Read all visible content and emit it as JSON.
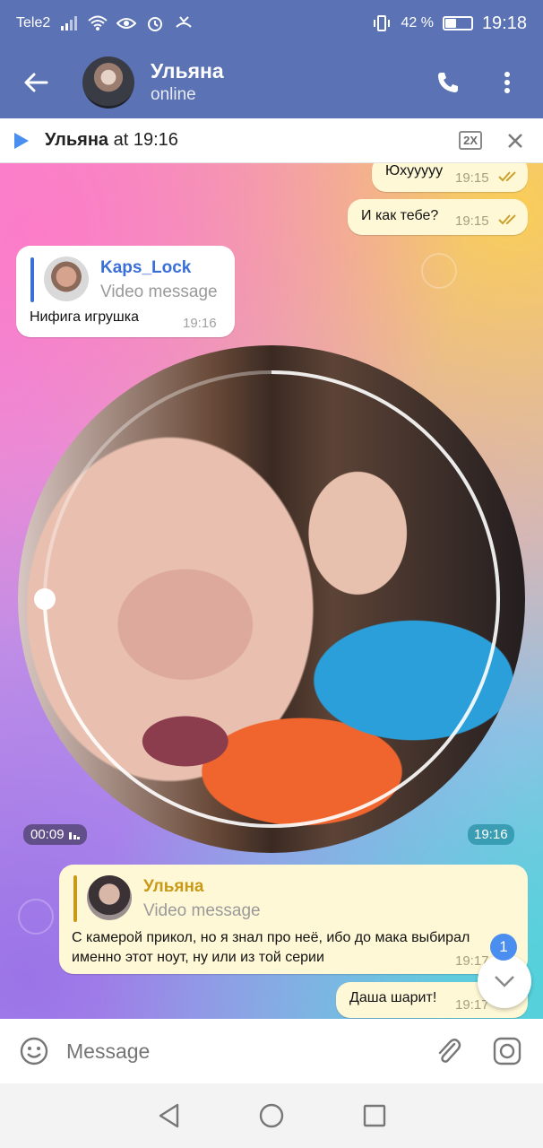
{
  "status_bar": {
    "carrier": "Tele2",
    "battery": "42 %",
    "battery_level": 0.42,
    "time": "19:18"
  },
  "header": {
    "name": "Ульяна",
    "status": "online"
  },
  "player": {
    "name": "Ульяна",
    "at": "at 19:16",
    "speed": "2X"
  },
  "messages": {
    "m1": {
      "text": "Юхууууу",
      "time": "19:15"
    },
    "m2": {
      "text": "И как тебе?",
      "time": "19:15"
    },
    "m3": {
      "reply_name": "Kaps_Lock",
      "reply_sub": "Video message",
      "text": "Нифига игрушка",
      "time": "19:16"
    },
    "video": {
      "duration": "00:09",
      "time": "19:16",
      "progress": 0.75
    },
    "m4": {
      "reply_name": "Ульяна",
      "reply_sub": "Video message",
      "text_line1": "С камерой прикол, но я знал про неё, ибо до мака выбирал",
      "text_line2": "именно этот ноут, ну или из той серии",
      "time": "19:17"
    },
    "m5": {
      "text": "Даша шарит!",
      "time": "19:17"
    }
  },
  "scroll": {
    "unread": "1"
  },
  "input": {
    "placeholder": "Message"
  },
  "colors": {
    "header": "#5b73b4",
    "accent": "#4a8ef0",
    "reply_in": "#3a6fd8",
    "reply_out": "#c89a17"
  }
}
